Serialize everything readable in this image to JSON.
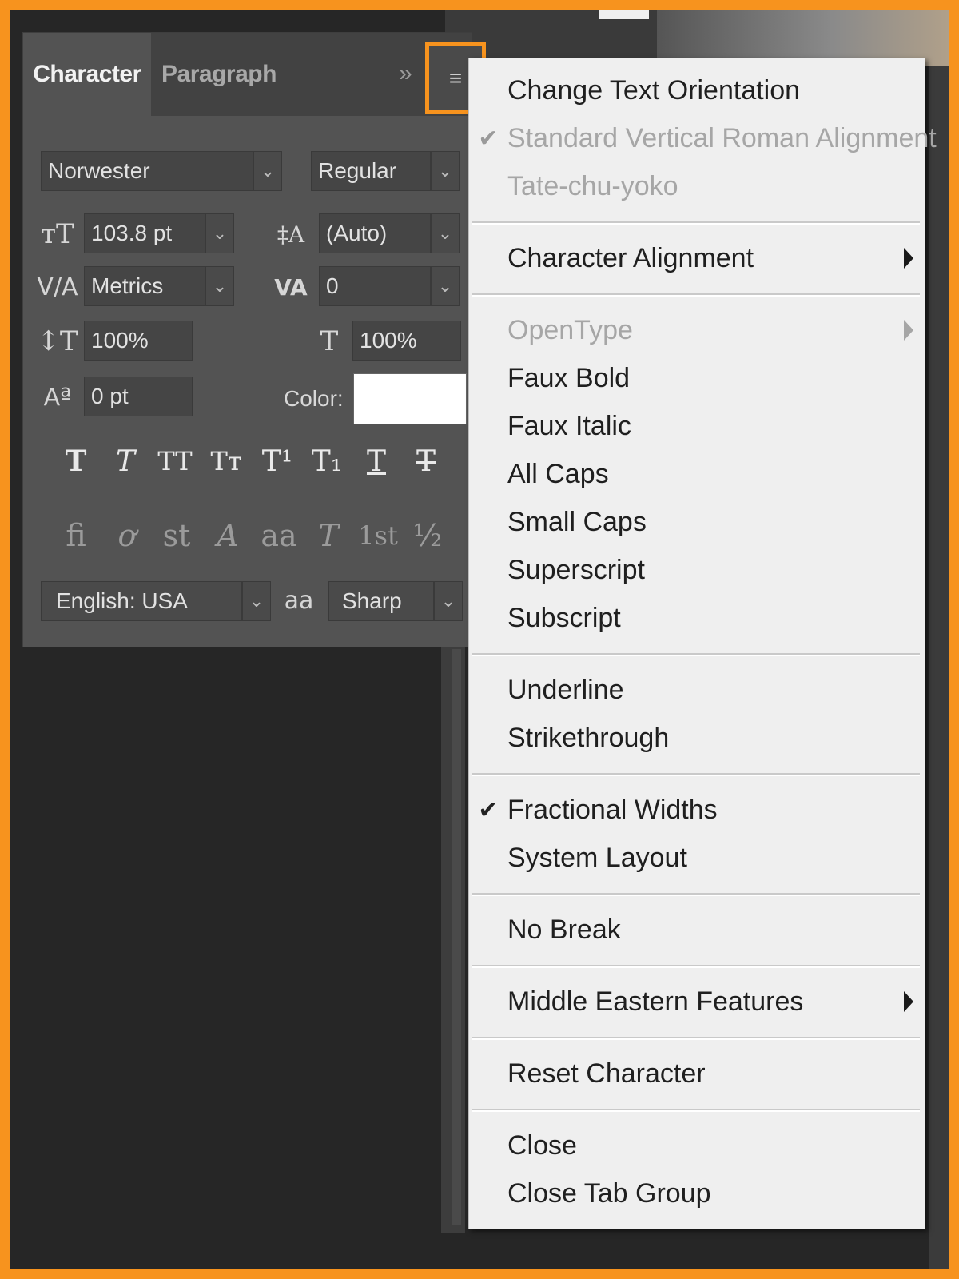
{
  "panel": {
    "tabs": [
      "Character",
      "Paragraph"
    ],
    "collapse_glyph": "»",
    "menu_glyph": "≡",
    "font_family": "Norwester",
    "font_style": "Regular",
    "font_size": "103.8 pt",
    "leading": "(Auto)",
    "kerning": "Metrics",
    "tracking": "0",
    "vertical_scale": "100%",
    "horizontal_scale": "100%",
    "baseline_shift": "0 pt",
    "color_label": "Color:",
    "color_value": "#ffffff",
    "language": "English: USA",
    "antialias": "Sharp",
    "antialias_glyph": "aa",
    "dropdown_glyph": "⌄",
    "style_buttons": [
      "T",
      "T",
      "TT",
      "Tт",
      "T¹",
      "T₁",
      "T",
      "T"
    ],
    "opentype_buttons": [
      "ﬁ",
      "ơ",
      "st",
      "A",
      "aa",
      "T",
      "1st",
      "½"
    ]
  },
  "menu": {
    "groups": [
      [
        {
          "label": "Change Text Orientation",
          "checked": false,
          "disabled": false,
          "submenu": false
        },
        {
          "label": "Standard Vertical Roman Alignment",
          "checked": true,
          "disabled": true,
          "submenu": false
        },
        {
          "label": "Tate-chu-yoko",
          "checked": false,
          "disabled": true,
          "submenu": false
        }
      ],
      [
        {
          "label": "Character Alignment",
          "checked": false,
          "disabled": false,
          "submenu": true
        }
      ],
      [
        {
          "label": "OpenType",
          "checked": false,
          "disabled": true,
          "submenu": true
        },
        {
          "label": "Faux Bold",
          "checked": false,
          "disabled": false,
          "submenu": false
        },
        {
          "label": "Faux Italic",
          "checked": false,
          "disabled": false,
          "submenu": false
        },
        {
          "label": "All Caps",
          "checked": false,
          "disabled": false,
          "submenu": false
        },
        {
          "label": "Small Caps",
          "checked": false,
          "disabled": false,
          "submenu": false
        },
        {
          "label": "Superscript",
          "checked": false,
          "disabled": false,
          "submenu": false
        },
        {
          "label": "Subscript",
          "checked": false,
          "disabled": false,
          "submenu": false
        }
      ],
      [
        {
          "label": "Underline",
          "checked": false,
          "disabled": false,
          "submenu": false
        },
        {
          "label": "Strikethrough",
          "checked": false,
          "disabled": false,
          "submenu": false
        }
      ],
      [
        {
          "label": "Fractional Widths",
          "checked": true,
          "disabled": false,
          "submenu": false
        },
        {
          "label": "System Layout",
          "checked": false,
          "disabled": false,
          "submenu": false
        }
      ],
      [
        {
          "label": "No Break",
          "checked": false,
          "disabled": false,
          "submenu": false
        }
      ],
      [
        {
          "label": "Middle Eastern Features",
          "checked": false,
          "disabled": false,
          "submenu": true
        }
      ],
      [
        {
          "label": "Reset Character",
          "checked": false,
          "disabled": false,
          "submenu": false
        }
      ],
      [
        {
          "label": "Close",
          "checked": false,
          "disabled": false,
          "submenu": false
        },
        {
          "label": "Close Tab Group",
          "checked": false,
          "disabled": false,
          "submenu": false
        }
      ]
    ],
    "check_glyph": "✔"
  }
}
